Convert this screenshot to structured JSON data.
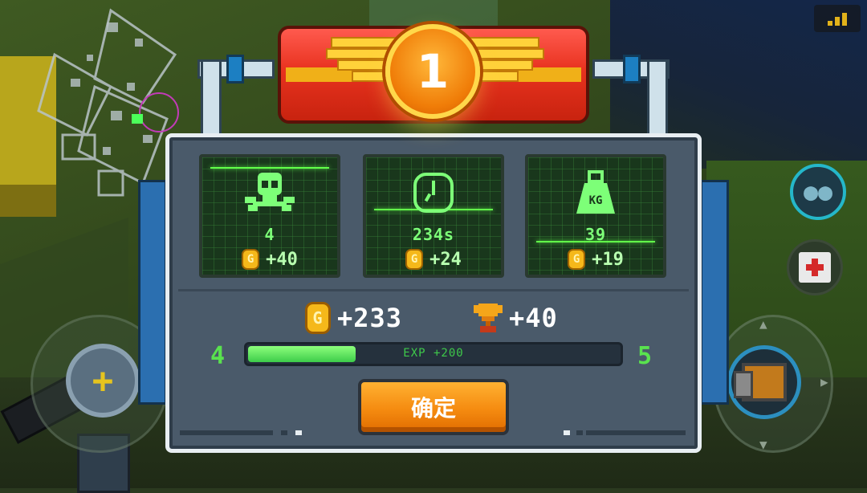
{
  "hud": {
    "signal_icon": "signal-bars-icon",
    "team_icon": "team-icon",
    "medkit_icon": "medkit-icon",
    "weapon_icon": "weapon-crate-icon",
    "joystick_icon": "plus-icon",
    "colors": {
      "hud_accent": "#25b7c9",
      "weapon_ring": "#2c8fbf",
      "joystick_plus": "#e6c41e"
    }
  },
  "result": {
    "rank": "1",
    "stats": [
      {
        "icon": "skull-icon",
        "value": "4",
        "reward": "+40"
      },
      {
        "icon": "clock-icon",
        "value": "234s",
        "reward": "+24"
      },
      {
        "icon": "weight-icon",
        "value": "39",
        "weight_label": "KG",
        "reward": "+19"
      }
    ],
    "totals": {
      "coins": "+233",
      "trophies": "+40"
    },
    "level": {
      "current": "4",
      "next": "5",
      "exp_label": "EXP +200",
      "progress": 0.29
    },
    "confirm_label": "确定",
    "coin_symbol": "G",
    "colors": {
      "banner": "#e8321f",
      "medal": "#f07d08",
      "stat_green": "#7dff78",
      "button": "#f58b10",
      "exp_bar": "#3dcc4a"
    }
  }
}
